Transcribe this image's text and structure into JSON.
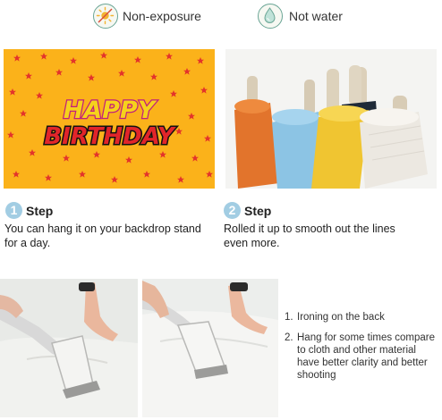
{
  "features": [
    {
      "icon": "sun-icon",
      "label": "Non-exposure"
    },
    {
      "icon": "water-drop-icon",
      "label": "Not water"
    }
  ],
  "banner": {
    "line1": "HAPPY",
    "line2": "BIRTHDAY",
    "colors": {
      "background": "#fbb21a",
      "stars": "#e3342b",
      "text_top": "#f6d21c",
      "text_bottom": "#e1252a"
    }
  },
  "steps": [
    {
      "number": "1",
      "title": "Step",
      "description": "You can hang it on your backdrop stand for a day."
    },
    {
      "number": "2",
      "title": "Step",
      "description": "Rolled it up to smooth out the lines even more."
    }
  ],
  "instructions": [
    {
      "number": "1.",
      "text": "Ironing on the back"
    },
    {
      "number": "2.",
      "text": "Hang for some times compare to cloth and other material have better clarity and better shooting"
    }
  ]
}
